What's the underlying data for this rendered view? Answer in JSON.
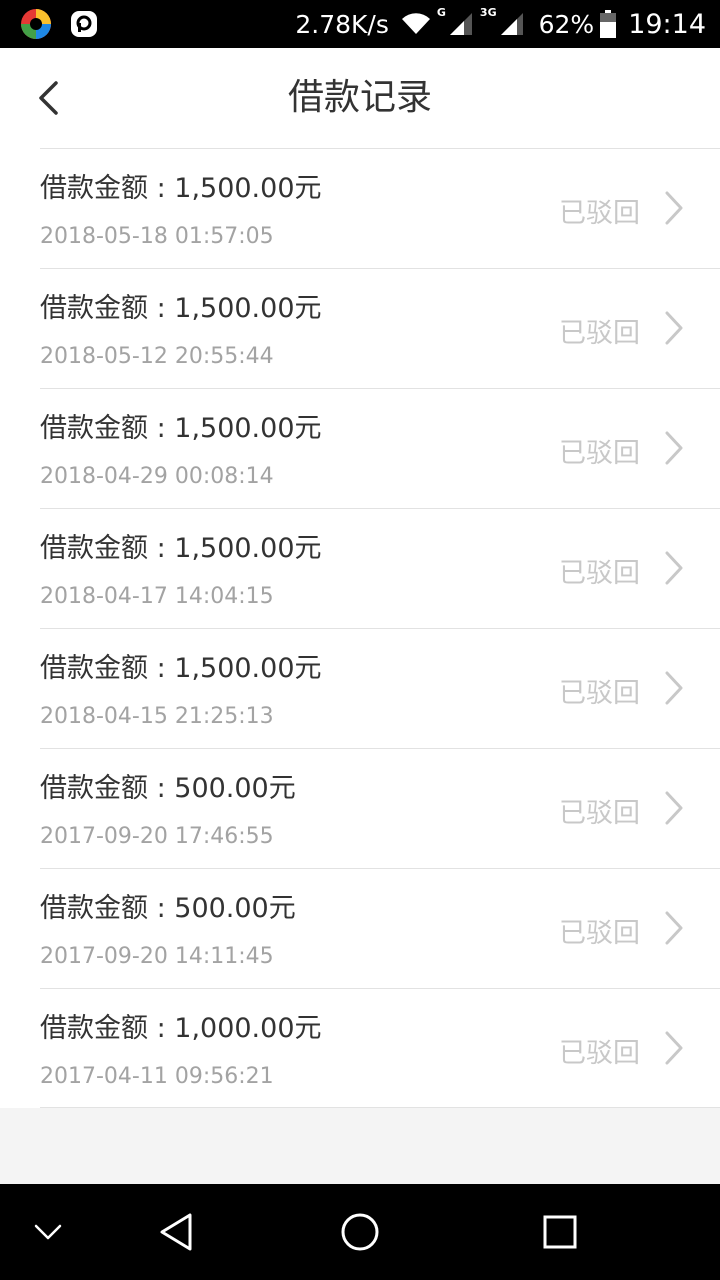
{
  "status_bar": {
    "net_speed": "2.78K/s",
    "net_type_1": "G",
    "net_type_2": "3G",
    "battery": "62%",
    "time": "19:14"
  },
  "header": {
    "title": "借款记录",
    "back_icon": "chevron-left-icon"
  },
  "records": [
    {
      "amount": "借款金额 : 1,500.00元",
      "timestamp": "2018-05-18 01:57:05",
      "status": "已驳回"
    },
    {
      "amount": "借款金额 : 1,500.00元",
      "timestamp": "2018-05-12 20:55:44",
      "status": "已驳回"
    },
    {
      "amount": "借款金额 : 1,500.00元",
      "timestamp": "2018-04-29 00:08:14",
      "status": "已驳回"
    },
    {
      "amount": "借款金额 : 1,500.00元",
      "timestamp": "2018-04-17 14:04:15",
      "status": "已驳回"
    },
    {
      "amount": "借款金额 : 1,500.00元",
      "timestamp": "2018-04-15 21:25:13",
      "status": "已驳回"
    },
    {
      "amount": "借款金额 : 500.00元",
      "timestamp": "2017-09-20 17:46:55",
      "status": "已驳回"
    },
    {
      "amount": "借款金额 : 500.00元",
      "timestamp": "2017-09-20 14:11:45",
      "status": "已驳回"
    },
    {
      "amount": "借款金额 : 1,000.00元",
      "timestamp": "2017-04-11 09:56:21",
      "status": "已驳回"
    }
  ],
  "colors": {
    "title": "#333333",
    "timestamp": "#a3a3a3",
    "status_rejected": "#c8c8c8",
    "divider": "#e2e2e2"
  },
  "nav_bar": {
    "icons": [
      "chevron-down-icon",
      "back-triangle-icon",
      "home-circle-icon",
      "recents-square-icon"
    ]
  }
}
